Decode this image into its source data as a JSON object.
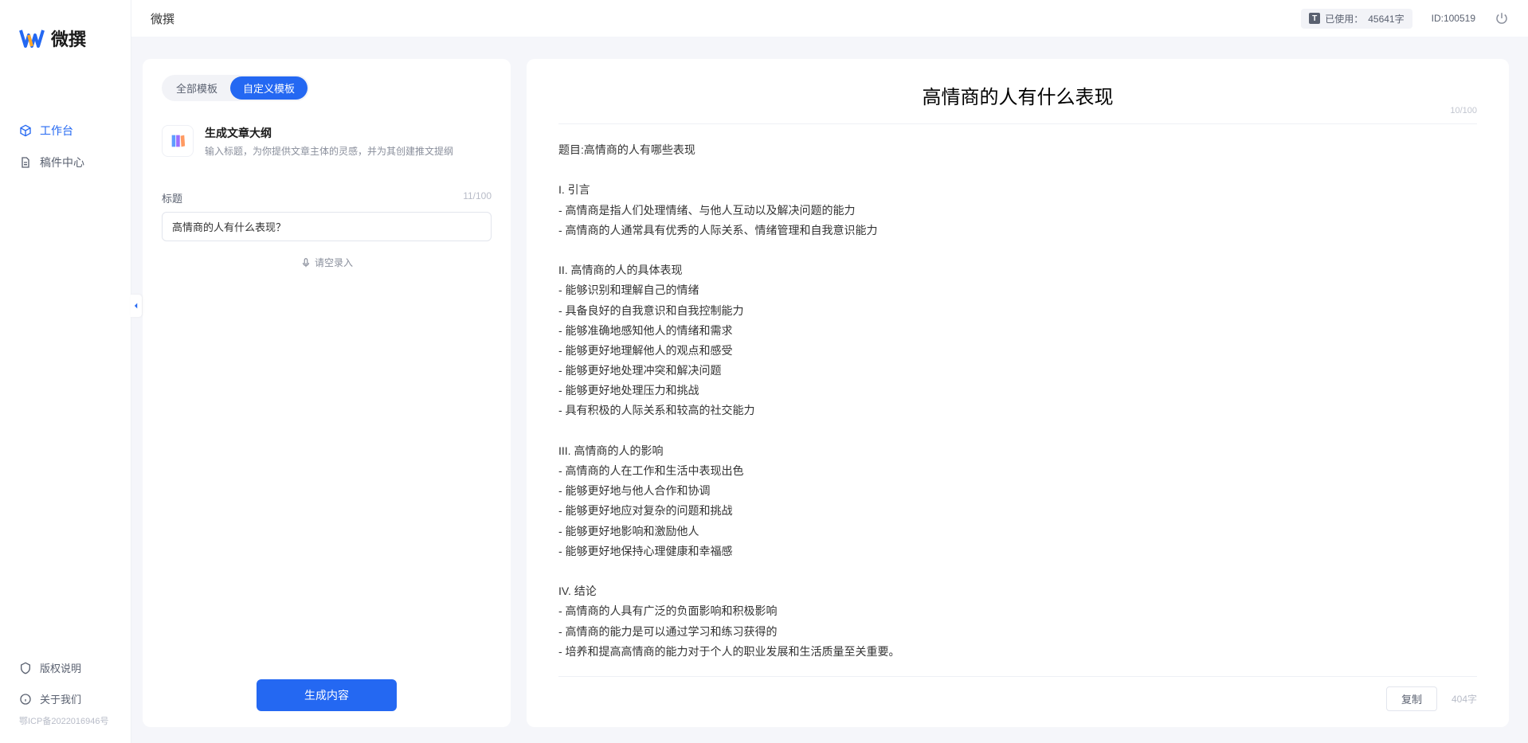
{
  "app": {
    "name": "微撰",
    "logoColors": {
      "a": "#2468f2",
      "b": "#ffa726",
      "c": "#66bb6a"
    }
  },
  "sidebar": {
    "items": [
      {
        "label": "工作台",
        "active": true
      },
      {
        "label": "稿件中心",
        "active": false
      }
    ],
    "bottom": [
      {
        "label": "版权说明"
      },
      {
        "label": "关于我们"
      }
    ],
    "icp": "鄂ICP备2022016946号"
  },
  "topbar": {
    "title": "微撰",
    "usagePrefix": "已使用：",
    "usageValue": "45641字",
    "idLabel": "ID:100519"
  },
  "leftPanel": {
    "tabs": [
      {
        "label": "全部模板",
        "active": false
      },
      {
        "label": "自定义模板",
        "active": true
      }
    ],
    "template": {
      "title": "生成文章大纲",
      "desc": "输入标题，为你提供文章主体的灵感，并为其创建推文提纲"
    },
    "field": {
      "label": "标题",
      "counter": "11/100",
      "value": "高情商的人有什么表现？"
    },
    "voiceLabel": "请空录入",
    "generateLabel": "生成内容"
  },
  "output": {
    "title": "高情商的人有什么表现",
    "titleCounter": "10/100",
    "body": "题目:高情商的人有哪些表现\n\nI. 引言\n- 高情商是指人们处理情绪、与他人互动以及解决问题的能力\n- 高情商的人通常具有优秀的人际关系、情绪管理和自我意识能力\n\nII. 高情商的人的具体表现\n- 能够识别和理解自己的情绪\n- 具备良好的自我意识和自我控制能力\n- 能够准确地感知他人的情绪和需求\n- 能够更好地理解他人的观点和感受\n- 能够更好地处理冲突和解决问题\n- 能够更好地处理压力和挑战\n- 具有积极的人际关系和较高的社交能力\n\nIII. 高情商的人的影响\n- 高情商的人在工作和生活中表现出色\n- 能够更好地与他人合作和协调\n- 能够更好地应对复杂的问题和挑战\n- 能够更好地影响和激励他人\n- 能够更好地保持心理健康和幸福感\n\nIV. 结论\n- 高情商的人具有广泛的负面影响和积极影响\n- 高情商的能力是可以通过学习和练习获得的\n- 培养和提高高情商的能力对于个人的职业发展和生活质量至关重要。",
    "copyLabel": "复制",
    "charCount": "404字"
  }
}
